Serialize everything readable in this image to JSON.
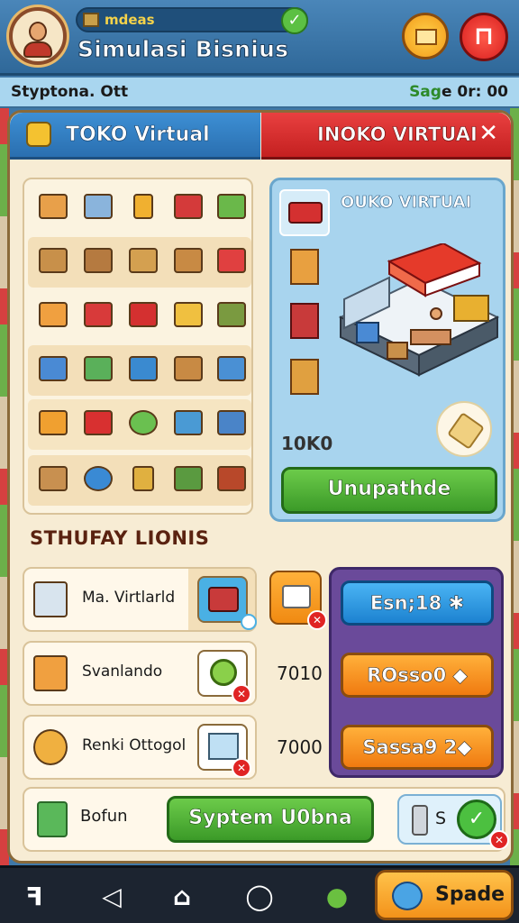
{
  "header": {
    "pill_text": "mdeas",
    "title": "Simulasi Bisnius"
  },
  "status": {
    "left": "Styptona. Ott",
    "right_prefix": "Sag",
    "right_value": "e 0r: 00"
  },
  "tabs": {
    "left_label": "TOKO Virtual",
    "right_label": "INOKO VIRTUAI",
    "close_glyph": "✕"
  },
  "store": {
    "title": "OUKO VIRTUAI",
    "price": "10K0",
    "upgrade_label": "Unupathde"
  },
  "section_title": "STHUFAY LIONIS",
  "list": {
    "items": [
      {
        "label": "Ma. Virtlarld",
        "value": ""
      },
      {
        "label": "Svanlando",
        "value": "7010"
      },
      {
        "label": "Renki Ottogol",
        "value": "7000"
      }
    ]
  },
  "actions": {
    "blue_label": "Esn;18",
    "orange1_label": "ROsso0",
    "orange2_label": "Sassa9 2"
  },
  "bottom": {
    "label": "Bofun",
    "system_button": "Syptem U0bna",
    "mini_text": "S",
    "ok_glyph": "✓"
  },
  "nav": {
    "spade_label": "Spade"
  },
  "colors": {
    "header_blue": "#2f6899",
    "panel_bg": "#f7ecd4",
    "tab_blue": "#2a6fb0",
    "tab_red": "#c42020",
    "green_button": "#3b9a28",
    "purple_panel": "#6a4a9a"
  }
}
